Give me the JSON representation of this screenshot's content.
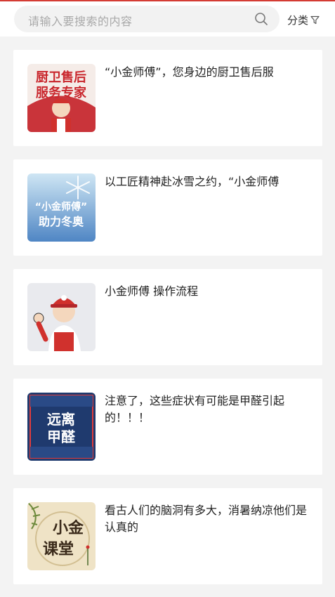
{
  "header": {
    "search_placeholder": "请输入要搜索的内容",
    "filter_label": "分类"
  },
  "articles": [
    {
      "title": "“小金师傅”，您身边的厨卫售后服",
      "thumb_text": [
        "厨卫售后",
        "服务专家"
      ]
    },
    {
      "title": "以工匠精神赴冰雪之约，“小金师傅",
      "thumb_text": [
        "“小金师傅”",
        "助力冬奥"
      ]
    },
    {
      "title": "小金师傅 操作流程",
      "thumb_text": []
    },
    {
      "title": "注意了，这些症状有可能是甲醛引起的！！！",
      "thumb_text": [
        "远离",
        "甲醛"
      ]
    },
    {
      "title": "看古人们的脑洞有多大，消暑纳凉他们是认真的",
      "thumb_text": [
        "小金",
        "课堂"
      ]
    }
  ],
  "colors": {
    "accent": "#d43b33",
    "background": "#f3f3f3",
    "card": "#ffffff"
  }
}
